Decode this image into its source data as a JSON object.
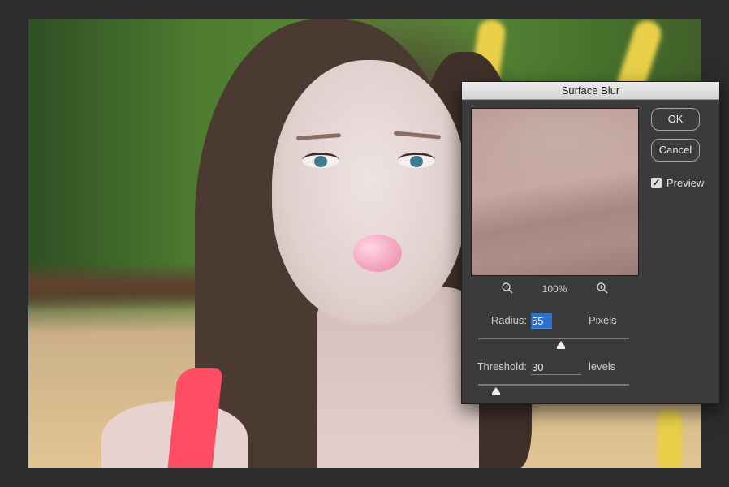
{
  "dialog": {
    "title": "Surface Blur",
    "ok_label": "OK",
    "cancel_label": "Cancel",
    "preview_label": "Preview",
    "preview_checked": true,
    "zoom": {
      "level": "100%",
      "zoom_out_icon": "zoom-out-icon",
      "zoom_in_icon": "zoom-in-icon"
    },
    "radius": {
      "label": "Radius:",
      "value": "55",
      "unit": "Pixels",
      "slider_fraction": 0.55
    },
    "threshold": {
      "label": "Threshold:",
      "value": "30",
      "unit": "levels",
      "slider_fraction": 0.12
    }
  },
  "colors": {
    "dialog_bg": "#3b3b3b",
    "workspace_bg": "#2c2c2c",
    "selection": "#2f6fcf",
    "focus_underline": "#4d8bd6"
  }
}
